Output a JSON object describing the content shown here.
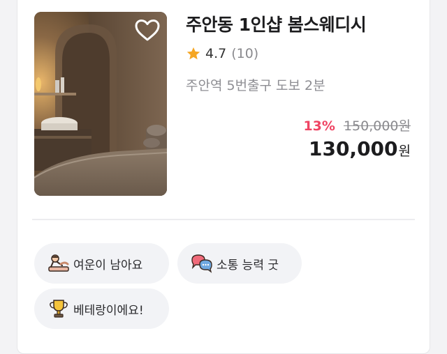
{
  "listing": {
    "title": "주안동 1인샵 봄스웨디시",
    "rating": "4.7",
    "review_count": "(10)",
    "location": "주안역 5번출구 도보 2분",
    "discount": "13%",
    "original_price": "150,000원",
    "price": "130,000",
    "currency": "원",
    "favorited": false
  },
  "tags": [
    {
      "label": "여운이 남아요",
      "icon": "massage-icon"
    },
    {
      "label": "소통 능력 굿",
      "icon": "chat-bubbles-icon"
    },
    {
      "label": "베테랑이에요!",
      "icon": "trophy-icon"
    }
  ],
  "colors": {
    "discount": "#ef4463",
    "star": "#f5a623",
    "chip_bg": "#f2f3f6"
  }
}
